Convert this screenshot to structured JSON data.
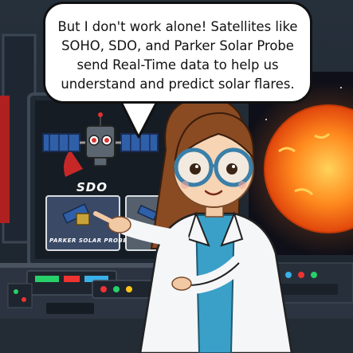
{
  "speech_bubble": {
    "line1": "But I don't work alone! Satellites like",
    "line2": "SOHO, SDO, and Parker Solar Probe",
    "line3": "send Real-Time data to help us",
    "line4": "understand and predict solar flares."
  },
  "screens": {
    "sdo_label": "SDO",
    "parker_label": "PARKER SOLAR PROBE"
  },
  "colors": {
    "sun": "#f26a10",
    "space_bg": "#1b2430",
    "lab_coat": "#f4f6f8",
    "shirt": "#3aa0c8",
    "hair": "#8a4a22",
    "console": "#2b3440"
  },
  "icons": [
    "robot-satellite-icon",
    "sun-icon",
    "satellite-icon"
  ]
}
